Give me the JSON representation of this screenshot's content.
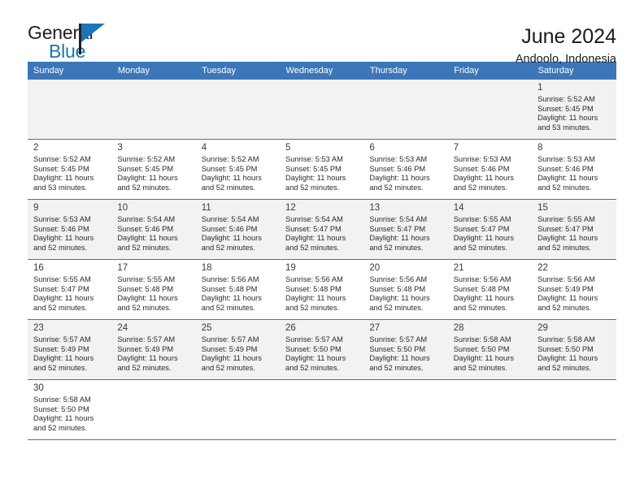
{
  "brand": {
    "name_top": "General",
    "name_bottom": "Blue",
    "color_dark": "#231f20",
    "color_blue": "#1b75bb"
  },
  "header": {
    "title": "June 2024",
    "subtitle": "Andoolo, Indonesia"
  },
  "theme": {
    "header_bg": "#3b76b8",
    "header_text": "#ffffff",
    "shaded_cell": "#f2f2f2",
    "plain_cell": "#ffffff",
    "grid_line": "#3b76b8"
  },
  "weekday_headers": [
    "Sunday",
    "Monday",
    "Tuesday",
    "Wednesday",
    "Thursday",
    "Friday",
    "Saturday"
  ],
  "weeks": [
    [
      {
        "day": "",
        "lines": []
      },
      {
        "day": "",
        "lines": []
      },
      {
        "day": "",
        "lines": []
      },
      {
        "day": "",
        "lines": []
      },
      {
        "day": "",
        "lines": []
      },
      {
        "day": "",
        "lines": []
      },
      {
        "day": "1",
        "lines": [
          "Sunrise: 5:52 AM",
          "Sunset: 5:45 PM",
          "Daylight: 11 hours",
          "and 53 minutes."
        ]
      }
    ],
    [
      {
        "day": "2",
        "lines": [
          "Sunrise: 5:52 AM",
          "Sunset: 5:45 PM",
          "Daylight: 11 hours",
          "and 53 minutes."
        ]
      },
      {
        "day": "3",
        "lines": [
          "Sunrise: 5:52 AM",
          "Sunset: 5:45 PM",
          "Daylight: 11 hours",
          "and 52 minutes."
        ]
      },
      {
        "day": "4",
        "lines": [
          "Sunrise: 5:52 AM",
          "Sunset: 5:45 PM",
          "Daylight: 11 hours",
          "and 52 minutes."
        ]
      },
      {
        "day": "5",
        "lines": [
          "Sunrise: 5:53 AM",
          "Sunset: 5:45 PM",
          "Daylight: 11 hours",
          "and 52 minutes."
        ]
      },
      {
        "day": "6",
        "lines": [
          "Sunrise: 5:53 AM",
          "Sunset: 5:46 PM",
          "Daylight: 11 hours",
          "and 52 minutes."
        ]
      },
      {
        "day": "7",
        "lines": [
          "Sunrise: 5:53 AM",
          "Sunset: 5:46 PM",
          "Daylight: 11 hours",
          "and 52 minutes."
        ]
      },
      {
        "day": "8",
        "lines": [
          "Sunrise: 5:53 AM",
          "Sunset: 5:46 PM",
          "Daylight: 11 hours",
          "and 52 minutes."
        ]
      }
    ],
    [
      {
        "day": "9",
        "lines": [
          "Sunrise: 5:53 AM",
          "Sunset: 5:46 PM",
          "Daylight: 11 hours",
          "and 52 minutes."
        ]
      },
      {
        "day": "10",
        "lines": [
          "Sunrise: 5:54 AM",
          "Sunset: 5:46 PM",
          "Daylight: 11 hours",
          "and 52 minutes."
        ]
      },
      {
        "day": "11",
        "lines": [
          "Sunrise: 5:54 AM",
          "Sunset: 5:46 PM",
          "Daylight: 11 hours",
          "and 52 minutes."
        ]
      },
      {
        "day": "12",
        "lines": [
          "Sunrise: 5:54 AM",
          "Sunset: 5:47 PM",
          "Daylight: 11 hours",
          "and 52 minutes."
        ]
      },
      {
        "day": "13",
        "lines": [
          "Sunrise: 5:54 AM",
          "Sunset: 5:47 PM",
          "Daylight: 11 hours",
          "and 52 minutes."
        ]
      },
      {
        "day": "14",
        "lines": [
          "Sunrise: 5:55 AM",
          "Sunset: 5:47 PM",
          "Daylight: 11 hours",
          "and 52 minutes."
        ]
      },
      {
        "day": "15",
        "lines": [
          "Sunrise: 5:55 AM",
          "Sunset: 5:47 PM",
          "Daylight: 11 hours",
          "and 52 minutes."
        ]
      }
    ],
    [
      {
        "day": "16",
        "lines": [
          "Sunrise: 5:55 AM",
          "Sunset: 5:47 PM",
          "Daylight: 11 hours",
          "and 52 minutes."
        ]
      },
      {
        "day": "17",
        "lines": [
          "Sunrise: 5:55 AM",
          "Sunset: 5:48 PM",
          "Daylight: 11 hours",
          "and 52 minutes."
        ]
      },
      {
        "day": "18",
        "lines": [
          "Sunrise: 5:56 AM",
          "Sunset: 5:48 PM",
          "Daylight: 11 hours",
          "and 52 minutes."
        ]
      },
      {
        "day": "19",
        "lines": [
          "Sunrise: 5:56 AM",
          "Sunset: 5:48 PM",
          "Daylight: 11 hours",
          "and 52 minutes."
        ]
      },
      {
        "day": "20",
        "lines": [
          "Sunrise: 5:56 AM",
          "Sunset: 5:48 PM",
          "Daylight: 11 hours",
          "and 52 minutes."
        ]
      },
      {
        "day": "21",
        "lines": [
          "Sunrise: 5:56 AM",
          "Sunset: 5:48 PM",
          "Daylight: 11 hours",
          "and 52 minutes."
        ]
      },
      {
        "day": "22",
        "lines": [
          "Sunrise: 5:56 AM",
          "Sunset: 5:49 PM",
          "Daylight: 11 hours",
          "and 52 minutes."
        ]
      }
    ],
    [
      {
        "day": "23",
        "lines": [
          "Sunrise: 5:57 AM",
          "Sunset: 5:49 PM",
          "Daylight: 11 hours",
          "and 52 minutes."
        ]
      },
      {
        "day": "24",
        "lines": [
          "Sunrise: 5:57 AM",
          "Sunset: 5:49 PM",
          "Daylight: 11 hours",
          "and 52 minutes."
        ]
      },
      {
        "day": "25",
        "lines": [
          "Sunrise: 5:57 AM",
          "Sunset: 5:49 PM",
          "Daylight: 11 hours",
          "and 52 minutes."
        ]
      },
      {
        "day": "26",
        "lines": [
          "Sunrise: 5:57 AM",
          "Sunset: 5:50 PM",
          "Daylight: 11 hours",
          "and 52 minutes."
        ]
      },
      {
        "day": "27",
        "lines": [
          "Sunrise: 5:57 AM",
          "Sunset: 5:50 PM",
          "Daylight: 11 hours",
          "and 52 minutes."
        ]
      },
      {
        "day": "28",
        "lines": [
          "Sunrise: 5:58 AM",
          "Sunset: 5:50 PM",
          "Daylight: 11 hours",
          "and 52 minutes."
        ]
      },
      {
        "day": "29",
        "lines": [
          "Sunrise: 5:58 AM",
          "Sunset: 5:50 PM",
          "Daylight: 11 hours",
          "and 52 minutes."
        ]
      }
    ],
    [
      {
        "day": "30",
        "lines": [
          "Sunrise: 5:58 AM",
          "Sunset: 5:50 PM",
          "Daylight: 11 hours",
          "and 52 minutes."
        ]
      },
      {
        "day": "",
        "lines": []
      },
      {
        "day": "",
        "lines": []
      },
      {
        "day": "",
        "lines": []
      },
      {
        "day": "",
        "lines": []
      },
      {
        "day": "",
        "lines": []
      },
      {
        "day": "",
        "lines": []
      }
    ]
  ]
}
